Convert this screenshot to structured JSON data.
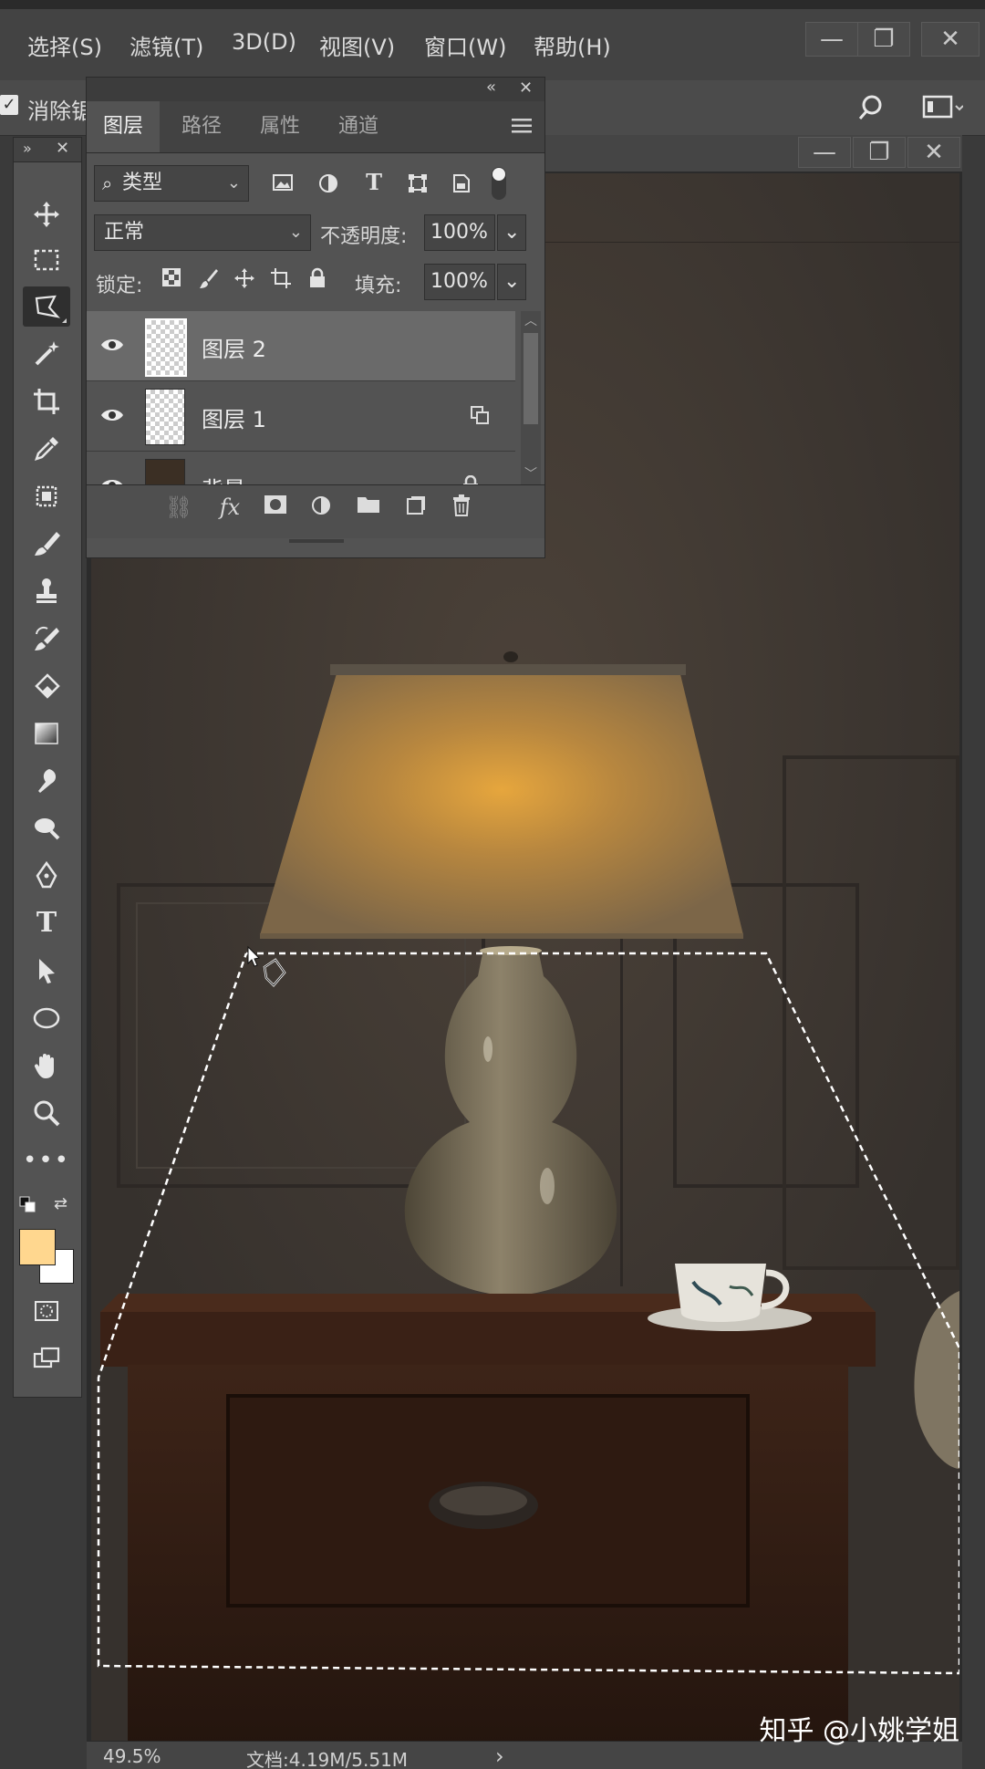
{
  "menu": {
    "items": [
      "选择(S)",
      "滤镜(T)",
      "3D(D)",
      "视图(V)",
      "窗口(W)",
      "帮助(H)"
    ],
    "window_buttons": {
      "minimize": "—",
      "restore": "❐",
      "close": "✕"
    }
  },
  "options_bar": {
    "checkbox_label": "消除锯",
    "search_icon": "search-icon",
    "workspace_icon": "workspace-icon"
  },
  "document": {
    "window_buttons": {
      "minimize": "—",
      "restore": "❐",
      "close": "✕"
    },
    "status": {
      "zoom": "49.5%",
      "doc_size": "文档:4.19M/5.51M",
      "arrow": "›"
    }
  },
  "layers_panel": {
    "collapse": "«",
    "close": "✕",
    "tabs": [
      {
        "label": "图层",
        "active": true
      },
      {
        "label": "路径",
        "active": false
      },
      {
        "label": "属性",
        "active": false
      },
      {
        "label": "通道",
        "active": false
      }
    ],
    "menu_icon": "hamburger-icon",
    "filter": {
      "label": "类型"
    },
    "blend_mode": "正常",
    "opacity_label": "不透明度:",
    "opacity_value": "100%",
    "lock_label": "锁定:",
    "fill_label": "填充:",
    "fill_value": "100%",
    "layers": [
      {
        "name": "图层 2",
        "selected": true,
        "visible": true,
        "badge": ""
      },
      {
        "name": "图层 1",
        "selected": false,
        "visible": true,
        "badge": "linked"
      },
      {
        "name": "背景",
        "selected": false,
        "visible": true,
        "badge": "lock"
      }
    ]
  },
  "colors": {
    "foreground": "#ffd78f",
    "background": "#ffffff",
    "panel": "#535353",
    "menubar": "#434343"
  },
  "watermark": "知乎 @小姚学姐"
}
